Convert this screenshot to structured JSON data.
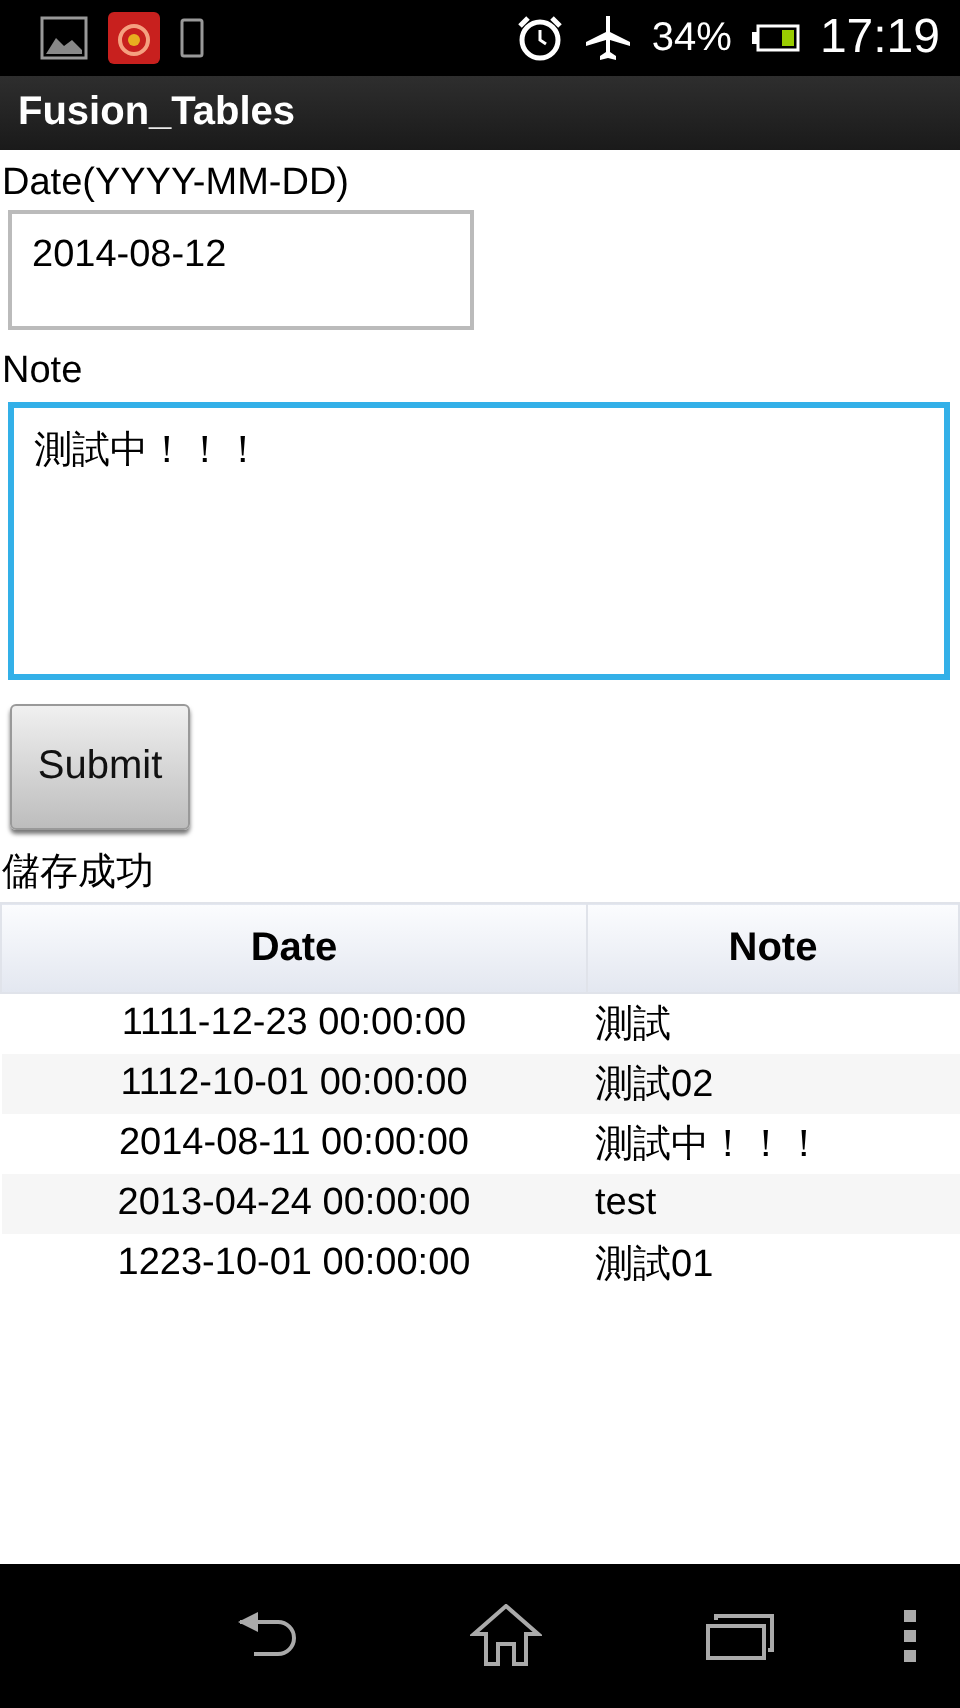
{
  "status_bar": {
    "battery": "34%",
    "time": "17:19"
  },
  "app_bar": {
    "title": "Fusion_Tables"
  },
  "form": {
    "date_label": "Date(YYYY-MM-DD)",
    "date_value": "2014-08-12",
    "date_focused": false,
    "note_label": "Note",
    "note_value": "測試中！！！",
    "note_focused": true,
    "submit": "Submit"
  },
  "message": "儲存成功",
  "table": {
    "columns": [
      "Date",
      "Note"
    ],
    "rows": [
      [
        "1111-12-23 00:00:00",
        "測試"
      ],
      [
        "1112-10-01 00:00:00",
        "測試02"
      ],
      [
        "2014-08-11 00:00:00",
        "測試中！！！"
      ],
      [
        "2013-04-24 00:00:00",
        "test"
      ],
      [
        "1223-10-01 00:00:00",
        "測試01"
      ]
    ]
  }
}
